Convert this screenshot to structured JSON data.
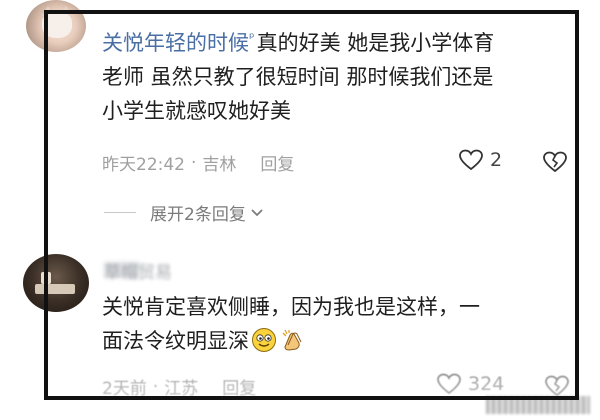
{
  "comment1": {
    "username": "关悦年轻的时候",
    "text_line1": "真的好美 她是我小学体育",
    "text_line2": "老师 虽然只教了很短时间 那时候我们还是",
    "text_line3": "小学生就感叹她好美",
    "time": "昨天22:42",
    "location": "吉林",
    "reply_label": "回复",
    "like_count": "2",
    "icons": {
      "user_badge": "search-small-icon",
      "like": "heart-icon",
      "dislike": "broken-heart-icon"
    }
  },
  "expand": {
    "label": "展开2条回复"
  },
  "comment2": {
    "username_blurred": "草帽贸易",
    "text_line1": "关悦肯定喜欢侧睡，因为我也是这样，一",
    "text_line2": "面法令纹明显深",
    "time": "2天前",
    "location": "江苏",
    "reply_label": "回复",
    "like_count": "324",
    "icons": {
      "emoji_a": "smiling-face-emoji",
      "emoji_b": "clapping-hands-emoji"
    }
  },
  "colors": {
    "username": "#4a6fa5",
    "text": "#1f1f1f",
    "meta": "#a0a0a0",
    "frame": "#111111"
  }
}
